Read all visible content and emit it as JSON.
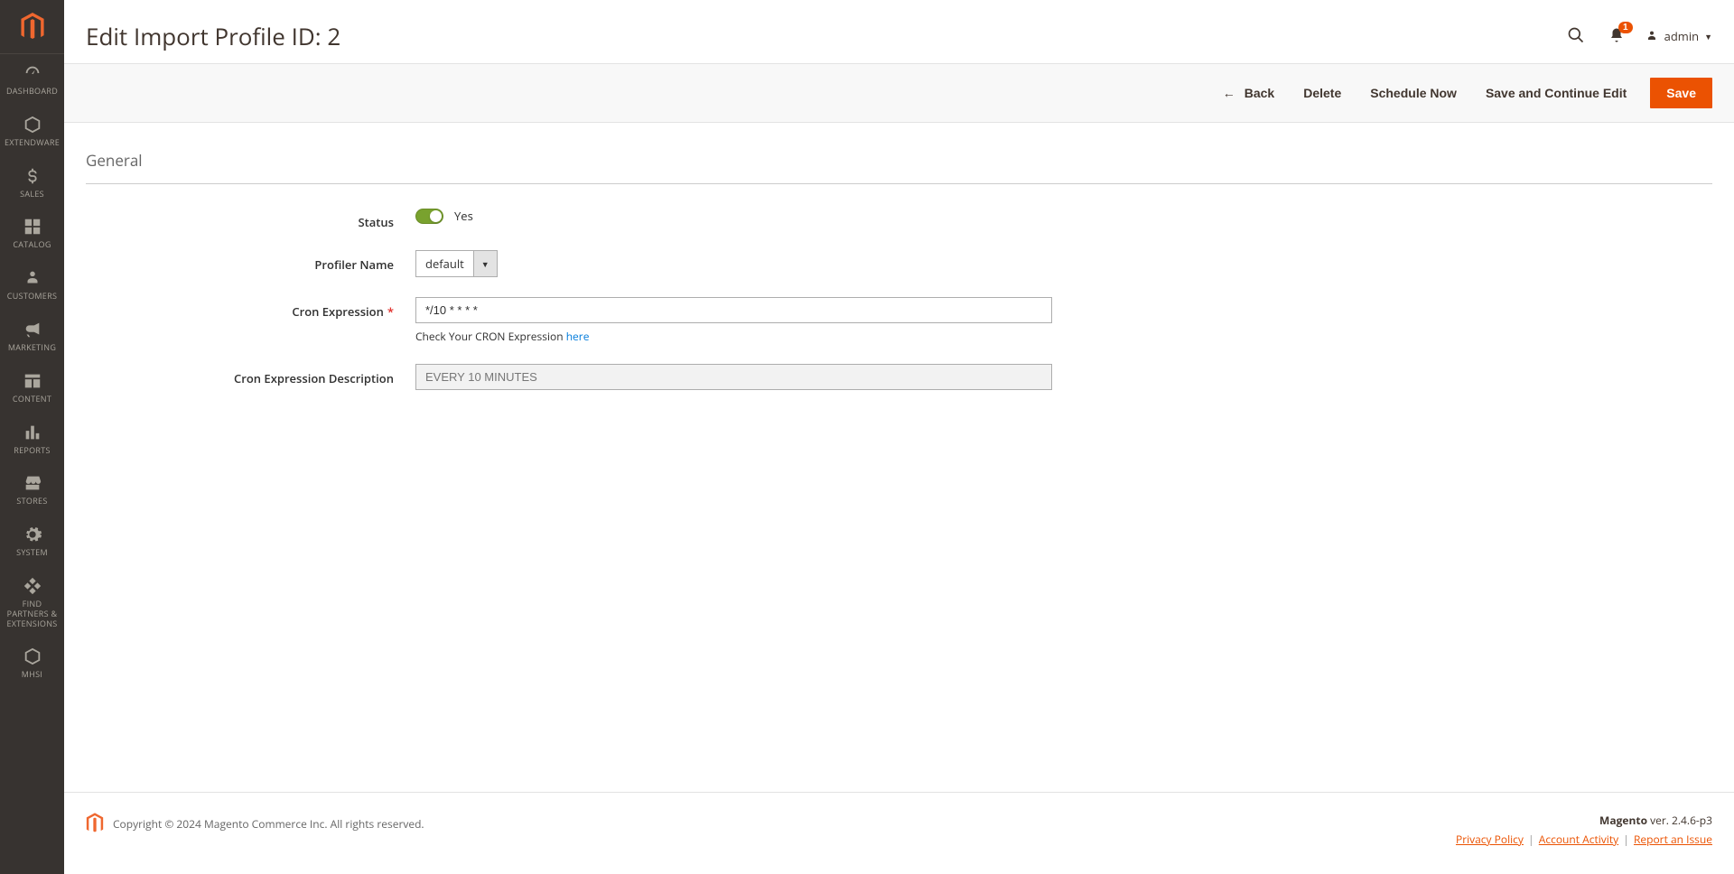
{
  "sidebar": {
    "items": [
      {
        "label": "DASHBOARD",
        "icon": "dashboard"
      },
      {
        "label": "EXTENDWARE",
        "icon": "hex"
      },
      {
        "label": "SALES",
        "icon": "dollar"
      },
      {
        "label": "CATALOG",
        "icon": "catalog"
      },
      {
        "label": "CUSTOMERS",
        "icon": "person"
      },
      {
        "label": "MARKETING",
        "icon": "megaphone"
      },
      {
        "label": "CONTENT",
        "icon": "content"
      },
      {
        "label": "REPORTS",
        "icon": "reports"
      },
      {
        "label": "STORES",
        "icon": "stores"
      },
      {
        "label": "SYSTEM",
        "icon": "gear"
      },
      {
        "label": "FIND PARTNERS & EXTENSIONS",
        "icon": "partners"
      },
      {
        "label": "MHSI",
        "icon": "hex"
      }
    ]
  },
  "header": {
    "page_title": "Edit Import Profile ID: 2",
    "admin_user": "admin",
    "notification_count": "1"
  },
  "actions": {
    "back": "Back",
    "delete": "Delete",
    "schedule": "Schedule Now",
    "save_continue": "Save and Continue Edit",
    "save": "Save"
  },
  "section": {
    "general_title": "General"
  },
  "form": {
    "status_label": "Status",
    "status_value": "Yes",
    "profiler_label": "Profiler Name",
    "profiler_value": "default",
    "cron_label": "Cron Expression",
    "cron_value": "*/10 * * * *",
    "cron_help_prefix": "Check Your CRON Expression ",
    "cron_help_link": "here",
    "cron_desc_label": "Cron Expression Description",
    "cron_desc_value": "EVERY 10 MINUTES"
  },
  "footer": {
    "copyright": "Copyright © 2024 Magento Commerce Inc. All rights reserved.",
    "brand": "Magento",
    "version": " ver. 2.4.6-p3",
    "privacy": "Privacy Policy",
    "activity": " Account Activity",
    "report": "Report an Issue"
  }
}
